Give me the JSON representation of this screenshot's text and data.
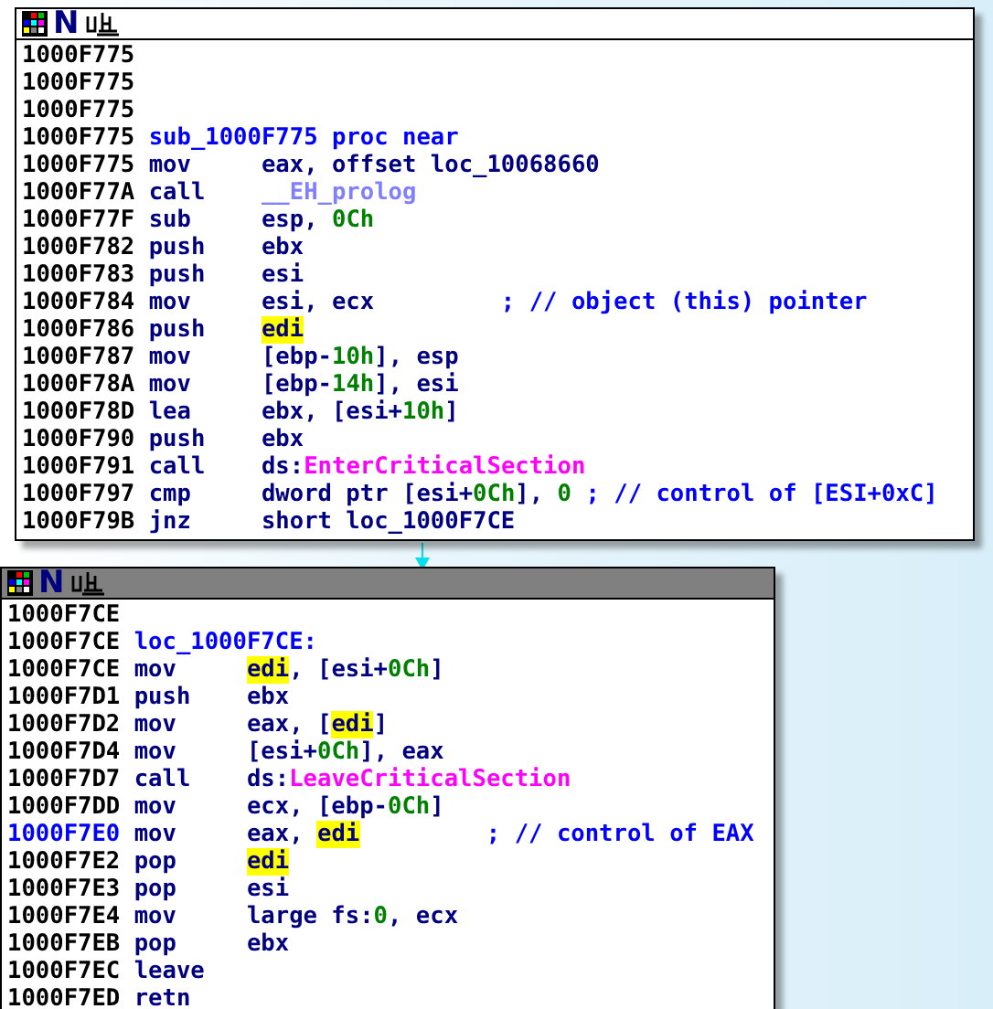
{
  "blocks": [
    {
      "active": false,
      "header_glyph": "N",
      "lines": [
        {
          "address": "1000F775",
          "selected": false
        },
        {
          "address": "1000F775",
          "selected": false
        },
        {
          "address": "1000F775",
          "selected": false
        },
        {
          "address": "1000F775",
          "selected": false,
          "label": "sub_1000F775 proc near"
        },
        {
          "address": "1000F775",
          "selected": false,
          "mnemonic": "mov",
          "operands": [
            {
              "text": "eax, offset loc_10068660",
              "kind": "plain"
            }
          ]
        },
        {
          "address": "1000F77A",
          "selected": false,
          "mnemonic": "call",
          "operands": [
            {
              "text": "__EH_prolog",
              "kind": "library"
            }
          ]
        },
        {
          "address": "1000F77F",
          "selected": false,
          "mnemonic": "sub",
          "operands": [
            {
              "text": "esp, ",
              "kind": "plain"
            },
            {
              "text": "0Ch",
              "kind": "number"
            }
          ]
        },
        {
          "address": "1000F782",
          "selected": false,
          "mnemonic": "push",
          "operands": [
            {
              "text": "ebx",
              "kind": "plain"
            }
          ]
        },
        {
          "address": "1000F783",
          "selected": false,
          "mnemonic": "push",
          "operands": [
            {
              "text": "esi",
              "kind": "plain"
            }
          ]
        },
        {
          "address": "1000F784",
          "selected": false,
          "mnemonic": "mov",
          "operands": [
            {
              "text": "esi, ecx",
              "kind": "plain"
            }
          ],
          "comment": "; // object (this) pointer"
        },
        {
          "address": "1000F786",
          "selected": false,
          "mnemonic": "push",
          "operands": [
            {
              "text": "edi",
              "kind": "highlight"
            }
          ]
        },
        {
          "address": "1000F787",
          "selected": false,
          "mnemonic": "mov",
          "operands": [
            {
              "text": "[ebp-",
              "kind": "plain"
            },
            {
              "text": "10h",
              "kind": "number"
            },
            {
              "text": "], esp",
              "kind": "plain"
            }
          ]
        },
        {
          "address": "1000F78A",
          "selected": false,
          "mnemonic": "mov",
          "operands": [
            {
              "text": "[ebp-",
              "kind": "plain"
            },
            {
              "text": "14h",
              "kind": "number"
            },
            {
              "text": "], esi",
              "kind": "plain"
            }
          ]
        },
        {
          "address": "1000F78D",
          "selected": false,
          "mnemonic": "lea",
          "operands": [
            {
              "text": "ebx, [esi+",
              "kind": "plain"
            },
            {
              "text": "10h",
              "kind": "number"
            },
            {
              "text": "]",
              "kind": "plain"
            }
          ]
        },
        {
          "address": "1000F790",
          "selected": false,
          "mnemonic": "push",
          "operands": [
            {
              "text": "ebx",
              "kind": "plain"
            }
          ]
        },
        {
          "address": "1000F791",
          "selected": false,
          "mnemonic": "call",
          "operands": [
            {
              "text": "ds:",
              "kind": "plain"
            },
            {
              "text": "EnterCriticalSection",
              "kind": "import"
            }
          ]
        },
        {
          "address": "1000F797",
          "selected": false,
          "mnemonic": "cmp",
          "operands": [
            {
              "text": "dword ptr [esi+",
              "kind": "plain"
            },
            {
              "text": "0Ch",
              "kind": "number"
            },
            {
              "text": "], ",
              "kind": "plain"
            },
            {
              "text": "0",
              "kind": "number"
            }
          ],
          "comment": "; // control of [ESI+0xC]"
        },
        {
          "address": "1000F79B",
          "selected": false,
          "mnemonic": "jnz",
          "operands": [
            {
              "text": "short loc_1000F7CE",
              "kind": "plain"
            }
          ]
        }
      ]
    },
    {
      "active": true,
      "header_glyph": "N",
      "lines": [
        {
          "address": "1000F7CE",
          "selected": false
        },
        {
          "address": "1000F7CE",
          "selected": false,
          "label": "loc_1000F7CE:"
        },
        {
          "address": "1000F7CE",
          "selected": false,
          "mnemonic": "mov",
          "operands": [
            {
              "text": "edi",
              "kind": "highlight"
            },
            {
              "text": ", [esi+",
              "kind": "plain"
            },
            {
              "text": "0Ch",
              "kind": "number"
            },
            {
              "text": "]",
              "kind": "plain"
            }
          ]
        },
        {
          "address": "1000F7D1",
          "selected": false,
          "mnemonic": "push",
          "operands": [
            {
              "text": "ebx",
              "kind": "plain"
            }
          ]
        },
        {
          "address": "1000F7D2",
          "selected": false,
          "mnemonic": "mov",
          "operands": [
            {
              "text": "eax, [",
              "kind": "plain"
            },
            {
              "text": "edi",
              "kind": "highlight"
            },
            {
              "text": "]",
              "kind": "plain"
            }
          ]
        },
        {
          "address": "1000F7D4",
          "selected": false,
          "mnemonic": "mov",
          "operands": [
            {
              "text": "[esi+",
              "kind": "plain"
            },
            {
              "text": "0Ch",
              "kind": "number"
            },
            {
              "text": "], eax",
              "kind": "plain"
            }
          ]
        },
        {
          "address": "1000F7D7",
          "selected": false,
          "mnemonic": "call",
          "operands": [
            {
              "text": "ds:",
              "kind": "plain"
            },
            {
              "text": "LeaveCriticalSection",
              "kind": "import"
            }
          ]
        },
        {
          "address": "1000F7DD",
          "selected": false,
          "mnemonic": "mov",
          "operands": [
            {
              "text": "ecx, [ebp-",
              "kind": "plain"
            },
            {
              "text": "0Ch",
              "kind": "number"
            },
            {
              "text": "]",
              "kind": "plain"
            }
          ]
        },
        {
          "address": "1000F7E0",
          "selected": true,
          "mnemonic": "mov",
          "operands": [
            {
              "text": "eax, ",
              "kind": "plain"
            },
            {
              "text": "edi",
              "kind": "highlight"
            }
          ],
          "comment": "; // control of EAX"
        },
        {
          "address": "1000F7E2",
          "selected": false,
          "mnemonic": "pop",
          "operands": [
            {
              "text": "edi",
              "kind": "highlight"
            }
          ]
        },
        {
          "address": "1000F7E3",
          "selected": false,
          "mnemonic": "pop",
          "operands": [
            {
              "text": "esi",
              "kind": "plain"
            }
          ]
        },
        {
          "address": "1000F7E4",
          "selected": false,
          "mnemonic": "mov",
          "operands": [
            {
              "text": "large fs:",
              "kind": "plain"
            },
            {
              "text": "0",
              "kind": "number"
            },
            {
              "text": ", ecx",
              "kind": "plain"
            }
          ]
        },
        {
          "address": "1000F7EB",
          "selected": false,
          "mnemonic": "pop",
          "operands": [
            {
              "text": "ebx",
              "kind": "plain"
            }
          ]
        },
        {
          "address": "1000F7EC",
          "selected": false,
          "mnemonic": "leave"
        },
        {
          "address": "1000F7ED",
          "selected": false,
          "mnemonic": "retn"
        }
      ]
    }
  ]
}
